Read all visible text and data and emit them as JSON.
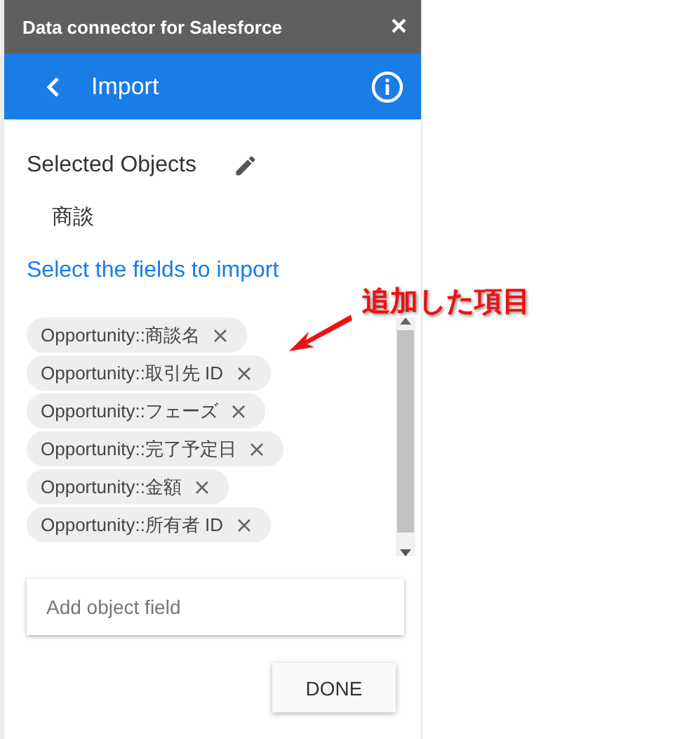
{
  "window": {
    "title": "Data connector for Salesforce",
    "close": "×"
  },
  "header": {
    "title": "Import"
  },
  "selected_objects": {
    "label": "Selected Objects",
    "items": [
      "商談"
    ]
  },
  "fields": {
    "heading": "Select the fields to import",
    "chips": [
      {
        "label": "Opportunity::商談名"
      },
      {
        "label": "Opportunity::取引先 ID"
      },
      {
        "label": "Opportunity::フェーズ"
      },
      {
        "label": "Opportunity::完了予定日"
      },
      {
        "label": "Opportunity::金額"
      },
      {
        "label": "Opportunity::所有者 ID"
      }
    ],
    "input": {
      "placeholder": "Add object field"
    }
  },
  "buttons": [
    "DONE"
  ],
  "annotation": {
    "text": "追加した項目"
  }
}
